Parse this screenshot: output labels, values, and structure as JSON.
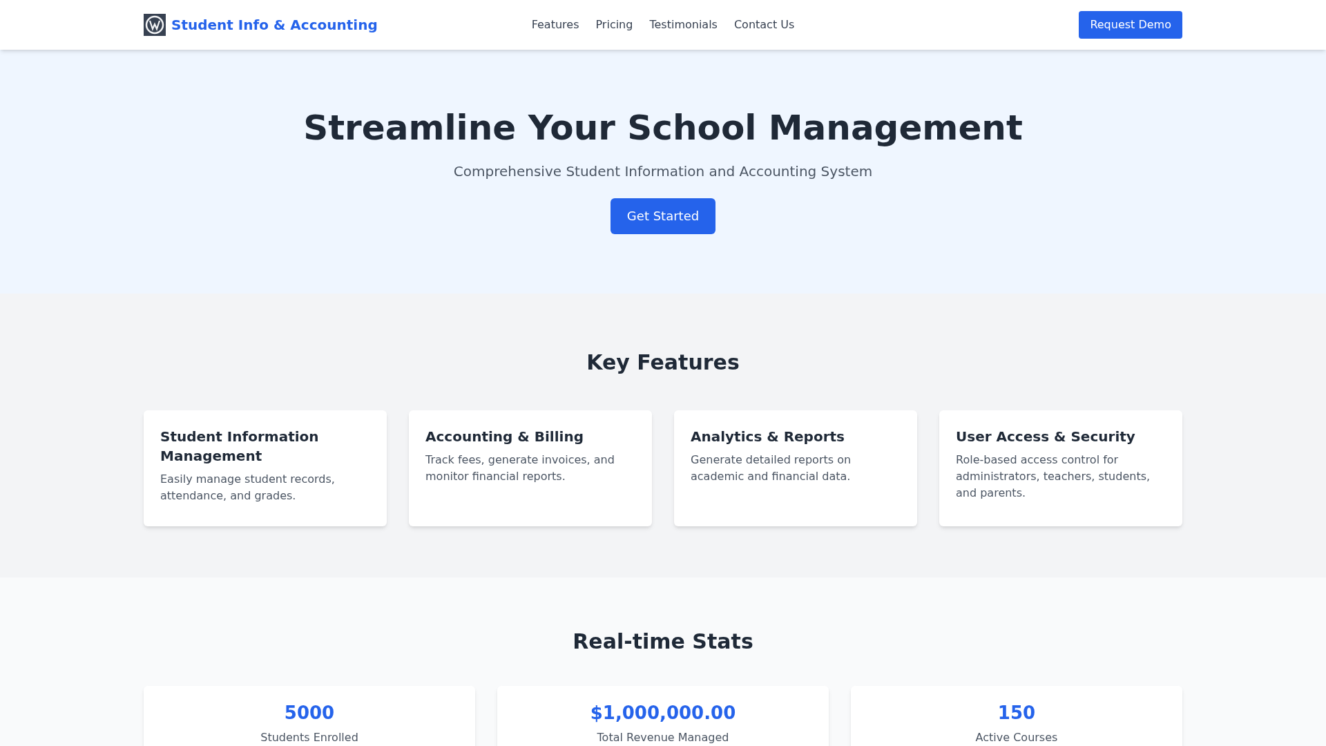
{
  "nav": {
    "brand": "Student Info & Accounting",
    "links": [
      "Features",
      "Pricing",
      "Testimonials",
      "Contact Us"
    ],
    "cta": "Request Demo"
  },
  "hero": {
    "title": "Streamline Your School Management",
    "subtitle": "Comprehensive Student Information and Accounting System",
    "button": "Get Started"
  },
  "features": {
    "heading": "Key Features",
    "cards": [
      {
        "title": "Student Information Management",
        "text": "Easily manage student records, attendance, and grades."
      },
      {
        "title": "Accounting & Billing",
        "text": "Track fees, generate invoices, and monitor financial reports."
      },
      {
        "title": "Analytics & Reports",
        "text": "Generate detailed reports on academic and financial data."
      },
      {
        "title": "User Access & Security",
        "text": "Role-based access control for administrators, teachers, students, and parents."
      }
    ]
  },
  "stats": {
    "heading": "Real-time Stats",
    "items": [
      {
        "value": "5000",
        "label": "Students Enrolled"
      },
      {
        "value": "$1,000,000.00",
        "label": "Total Revenue Managed"
      },
      {
        "value": "150",
        "label": "Active Courses"
      }
    ]
  }
}
